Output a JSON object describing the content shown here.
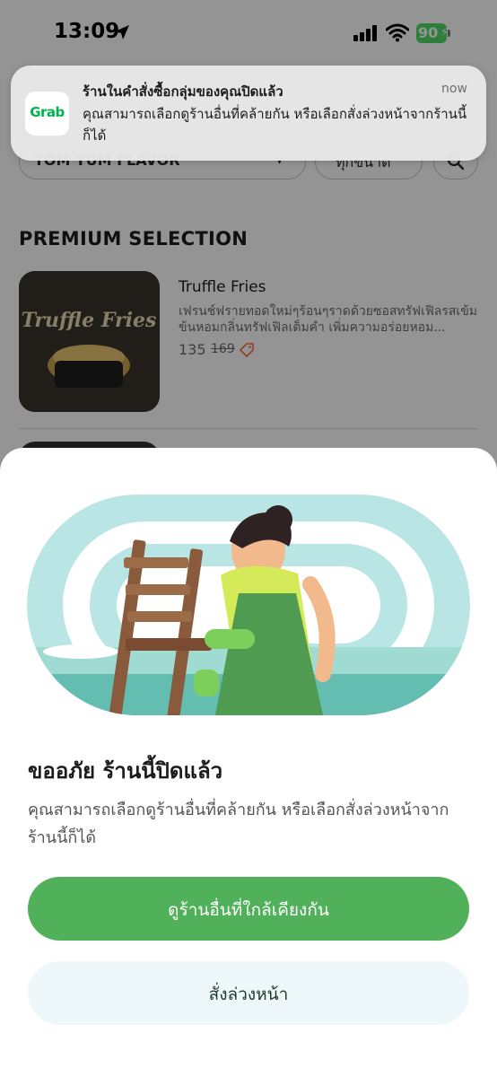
{
  "status_bar": {
    "time": "13:09",
    "battery": "90"
  },
  "background": {
    "search_value": "TOM YUM FLAVOR",
    "filter_label": "ทุกขนาด",
    "section_title": "PREMIUM SELECTION",
    "item": {
      "name": "Truffle Fries",
      "description": "เฟรนช์ฟรายทอดใหม่ๆร้อนๆราดด้วยซอสทรัฟเฟิลรสเข้มข้นหอมกลิ่นทรัฟเฟิลเต็มคำ เพิ่มความอร่อยหอม...",
      "price": "135",
      "old_price": "169",
      "thumb_caption": "Truffle Fries"
    }
  },
  "notification": {
    "app_name": "Grab",
    "title": "ร้านในคำสั่งซื้อกลุ่มของคุณปิดแล้ว",
    "time": "now",
    "body": "คุณสามารถเลือกดูร้านอื่นที่คล้ายกัน หรือเลือกสั่งล่วงหน้าจากร้านนี้ก็ได้"
  },
  "sheet": {
    "title": "ขออภัย ร้านนี้ปิดแล้ว",
    "description": "คุณสามารถเลือกดูร้านอื่นที่คล้ายกัน หรือเลือกสั่งล่วงหน้าจากร้านนี้ก็ได้",
    "primary_button": "ดูร้านอื่นที่ใกล้เคียงกัน",
    "secondary_button": "สั่งล่วงหน้า"
  },
  "colors": {
    "primary_green": "#51b15a",
    "grab_green": "#00b14f",
    "secondary_bg": "#eef7f9",
    "illustration_teal": "#b9e6e4"
  },
  "icons": [
    "location-arrow-icon",
    "signal-icon",
    "wifi-icon",
    "battery-icon",
    "search-icon",
    "tag-icon",
    "grab-app-icon"
  ]
}
